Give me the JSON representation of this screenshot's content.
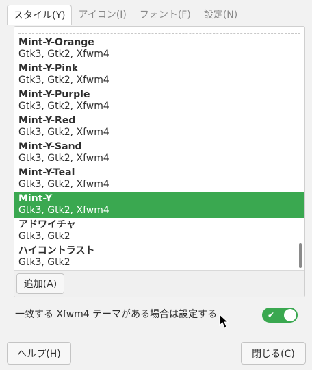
{
  "tabs": [
    {
      "label": "スタイル(Y)",
      "active": true
    },
    {
      "label": "アイコン(I)",
      "active": false
    },
    {
      "label": "フォント(F)",
      "active": false
    },
    {
      "label": "設定(N)",
      "active": false
    }
  ],
  "themes": [
    {
      "name": "Mint-Y-Orange",
      "sub": "Gtk3, Gtk2, Xfwm4"
    },
    {
      "name": "Mint-Y-Pink",
      "sub": "Gtk3, Gtk2, Xfwm4"
    },
    {
      "name": "Mint-Y-Purple",
      "sub": "Gtk3, Gtk2, Xfwm4"
    },
    {
      "name": "Mint-Y-Red",
      "sub": "Gtk3, Gtk2, Xfwm4"
    },
    {
      "name": "Mint-Y-Sand",
      "sub": "Gtk3, Gtk2, Xfwm4"
    },
    {
      "name": "Mint-Y-Teal",
      "sub": "Gtk3, Gtk2, Xfwm4"
    },
    {
      "name": "Mint-Y",
      "sub": "Gtk3, Gtk2, Xfwm4",
      "selected": true
    },
    {
      "name": "アドワイチャ",
      "sub": "Gtk3, Gtk2"
    },
    {
      "name": "ハイコントラスト",
      "sub": "Gtk3, Gtk2"
    }
  ],
  "add_button": "追加(A)",
  "option_label": "一致する Xfwm4 テーマがある場合は設定する",
  "option_enabled": true,
  "help_button": "ヘルプ(H)",
  "close_button": "閉じる(C)",
  "colors": {
    "accent": "#3aa850"
  }
}
